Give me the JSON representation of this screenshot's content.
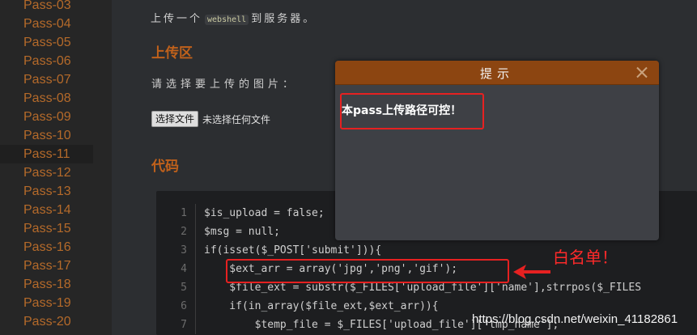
{
  "sidebar": {
    "items": [
      "Pass-03",
      "Pass-04",
      "Pass-05",
      "Pass-06",
      "Pass-07",
      "Pass-08",
      "Pass-09",
      "Pass-10",
      "Pass-11",
      "Pass-12",
      "Pass-13",
      "Pass-14",
      "Pass-15",
      "Pass-16",
      "Pass-17",
      "Pass-18",
      "Pass-19",
      "Pass-20"
    ],
    "active": "Pass-11"
  },
  "intro": {
    "before": "上传一个",
    "code": "webshell",
    "after": "到服务器。"
  },
  "upload_heading": "上传区",
  "choose_label": "请选择要上传的图片：",
  "file_input": {
    "button": "选择文件",
    "status": "未选择任何文件"
  },
  "code_heading": "代码",
  "code": {
    "lines": [
      {
        "n": "1",
        "text": "$is_upload = false;"
      },
      {
        "n": "2",
        "text": "$msg = null;"
      },
      {
        "n": "3",
        "text": "if(isset($_POST['submit'])){"
      },
      {
        "n": "4",
        "text": "    $ext_arr = array('jpg','png','gif');"
      },
      {
        "n": "5",
        "text": "    $file_ext = substr($_FILES['upload_file']['name'],strrpos($_FILES"
      },
      {
        "n": "6",
        "text": "    if(in_array($file_ext,$ext_arr)){"
      },
      {
        "n": "7",
        "text": "        $temp_file = $_FILES['upload_file']['tmp_name'];"
      }
    ]
  },
  "modal": {
    "title": "提示",
    "message": "本pass上传路径可控！"
  },
  "annotation": {
    "whitelist": "白名单！"
  },
  "watermark": "https://blog.csdn.net/weixin_41182861",
  "colors": {
    "accent": "#c0611b",
    "modal_header": "#8c4511",
    "annotation": "#e62121"
  }
}
